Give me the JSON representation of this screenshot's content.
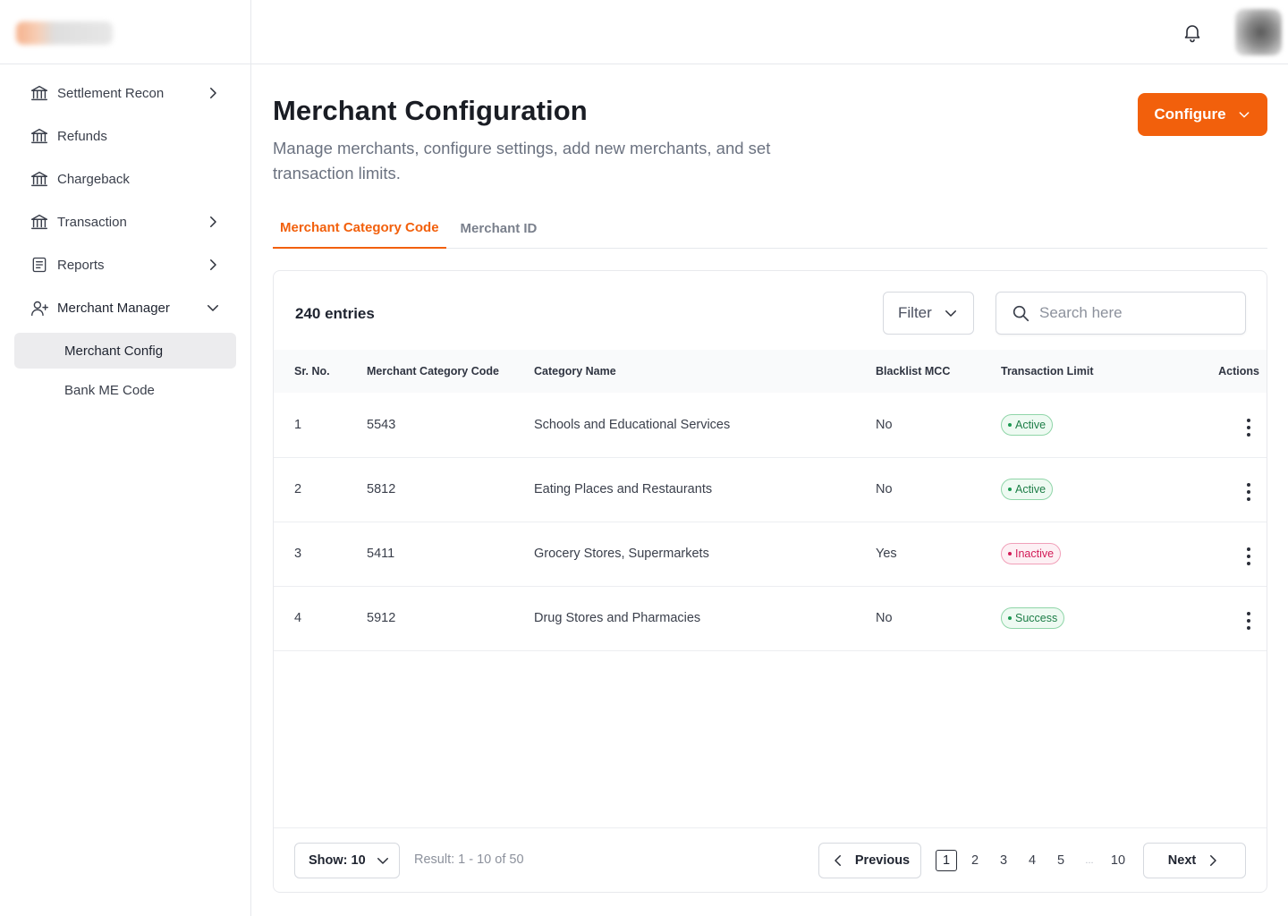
{
  "sidebar": {
    "items": [
      {
        "label": "Settlement Recon",
        "icon": "bank-icon",
        "has_chevron": true
      },
      {
        "label": "Refunds",
        "icon": "bank-icon",
        "has_chevron": false
      },
      {
        "label": "Chargeback",
        "icon": "bank-icon",
        "has_chevron": false
      },
      {
        "label": "Transaction",
        "icon": "bank-icon",
        "has_chevron": true
      },
      {
        "label": "Reports",
        "icon": "report-icon",
        "has_chevron": true
      },
      {
        "label": "Merchant Manager",
        "icon": "user-add-icon",
        "expanded": true
      }
    ],
    "sub_items": [
      {
        "label": "Merchant Config",
        "active": true
      },
      {
        "label": "Bank ME Code",
        "active": false
      }
    ]
  },
  "header": {
    "title": "Merchant Configuration",
    "subtitle": "Manage merchants, configure settings, add new merchants, and set transaction limits.",
    "configure_label": "Configure"
  },
  "tabs": [
    {
      "label": "Merchant Category Code",
      "active": true
    },
    {
      "label": "Merchant ID",
      "active": false
    }
  ],
  "table": {
    "entries_label": "240 entries",
    "filter_label": "Filter",
    "search_placeholder": "Search here",
    "columns": [
      "Sr. No.",
      "Merchant Category Code",
      "Category Name",
      "Blacklist MCC",
      "Transaction Limit",
      "Actions"
    ],
    "rows": [
      {
        "sr": "1",
        "mcc": "5543",
        "category": "Schools and Educational Services",
        "blacklist": "No",
        "limit": "Active",
        "limit_tone": "green"
      },
      {
        "sr": "2",
        "mcc": "5812",
        "category": "Eating Places and Restaurants",
        "blacklist": "No",
        "limit": "Active",
        "limit_tone": "green"
      },
      {
        "sr": "3",
        "mcc": "5411",
        "category": "Grocery Stores, Supermarkets",
        "blacklist": "Yes",
        "limit": "Inactive",
        "limit_tone": "red"
      },
      {
        "sr": "4",
        "mcc": "5912",
        "category": "Drug Stores and Pharmacies",
        "blacklist": "No",
        "limit": "Success",
        "limit_tone": "green"
      }
    ]
  },
  "footer": {
    "show_label": "Show: 10",
    "result_text": "Result: 1 - 10 of 50",
    "previous_label": "Previous",
    "next_label": "Next",
    "pages": [
      "1",
      "2",
      "3",
      "4",
      "5",
      "...",
      "10"
    ],
    "current_page": "1"
  },
  "colors": {
    "accent": "#f2600c",
    "success": "#1c7d46",
    "danger": "#d21b57"
  }
}
